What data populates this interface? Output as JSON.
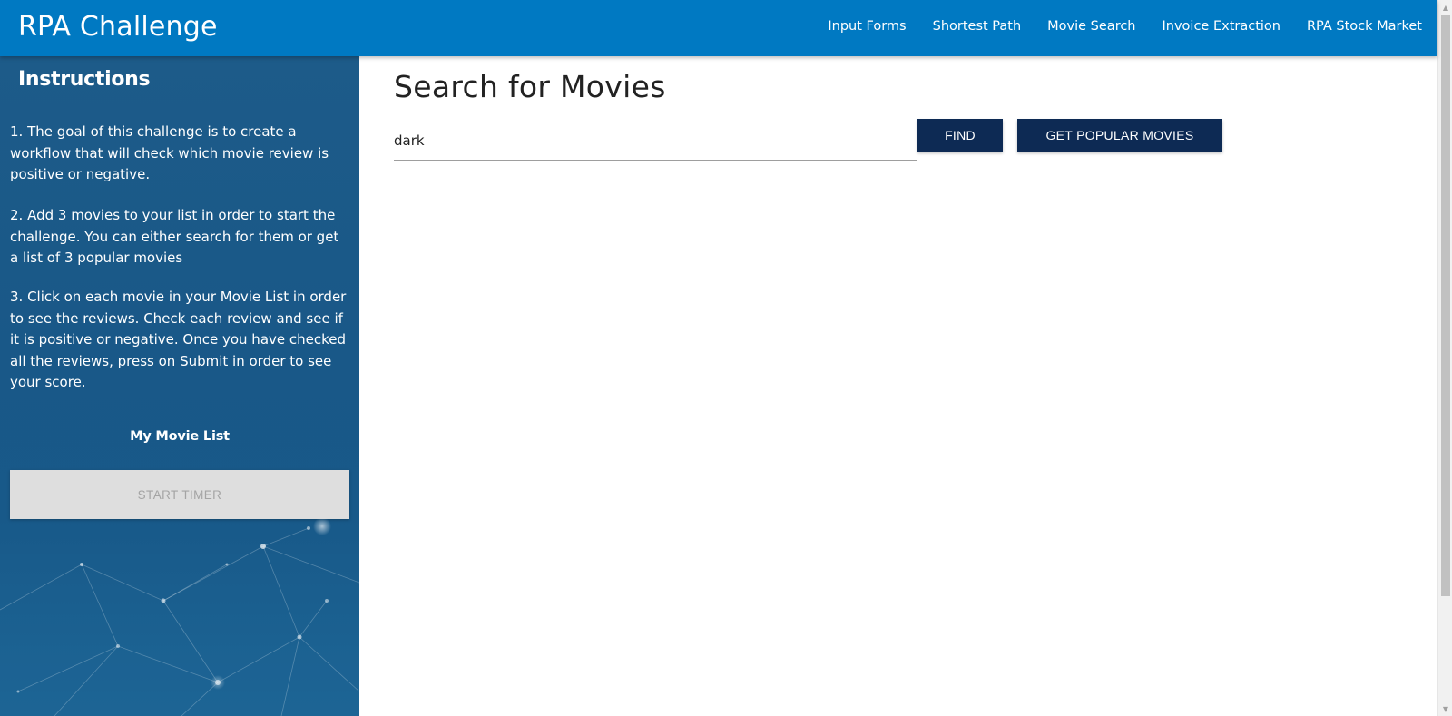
{
  "navbar": {
    "brand": "RPA Challenge",
    "links": [
      "Input Forms",
      "Shortest Path",
      "Movie Search",
      "Invoice Extraction",
      "RPA Stock Market"
    ]
  },
  "sidebar": {
    "title": "Instructions",
    "steps": [
      "1. The goal of this challenge is to create a workflow that will check which movie review is positive or negative.",
      "2. Add 3 movies to your list in order to start the challenge. You can either search for them or get a list of 3 popular movies",
      "3. Click on each movie in your Movie List in order to see the reviews. Check each review and see if it is positive or negative. Once you have checked all the reviews, press on Submit in order to see your score."
    ],
    "movie_list_label": "My Movie List",
    "start_timer_label": "START TIMER"
  },
  "main": {
    "title": "Search for Movies",
    "search_value": "dark",
    "find_label": "FIND",
    "popular_label": "GET POPULAR MOVIES"
  },
  "colors": {
    "navbar": "#0079c2",
    "button": "#0d2a54",
    "sidebar": "#1b5c8e",
    "disabled_button": "#dedede"
  },
  "icons": {
    "scroll_up": "triangle-up",
    "scroll_down": "triangle-down"
  }
}
